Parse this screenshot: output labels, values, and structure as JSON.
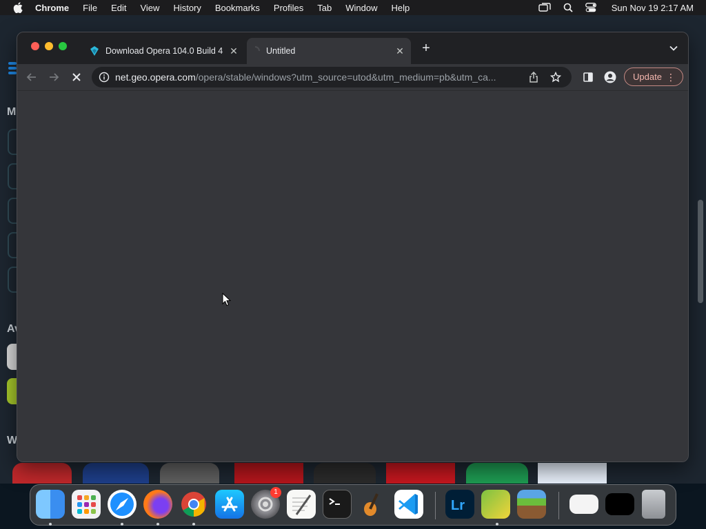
{
  "menubar": {
    "app_name": "Chrome",
    "items": [
      "File",
      "Edit",
      "View",
      "History",
      "Bookmarks",
      "Profiles",
      "Tab",
      "Window",
      "Help"
    ],
    "clock": "Sun Nov 19  2:17 AM"
  },
  "background_window": {
    "letters": [
      "M",
      "Av",
      "W"
    ]
  },
  "browser": {
    "tabs": [
      {
        "title": "Download Opera 104.0 Build 4",
        "favicon": "opera-download-icon"
      },
      {
        "title": "Untitled",
        "favicon": "loading-icon"
      }
    ],
    "address": {
      "host": "net.geo.opera.com",
      "path": "/opera/stable/windows?utm_source=utod&utm_medium=pb&utm_ca..."
    },
    "update_label": "Update",
    "state": "loading"
  },
  "dock": {
    "apps": [
      "Finder",
      "Launchpad",
      "Safari",
      "Firefox",
      "Chrome",
      "App Store",
      "System Settings",
      "TextEdit",
      "Terminal",
      "GarageBand",
      "Visual Studio Code",
      "Lightroom",
      "Game",
      "Minecraft",
      "Preview",
      "Window",
      "Trash"
    ],
    "system_settings_badge": "1"
  },
  "colors": {
    "menubar": "#1c1c1e",
    "browser_bg": "#35363a",
    "tabstrip": "#202124",
    "accent_update": "#f3b6ae"
  }
}
